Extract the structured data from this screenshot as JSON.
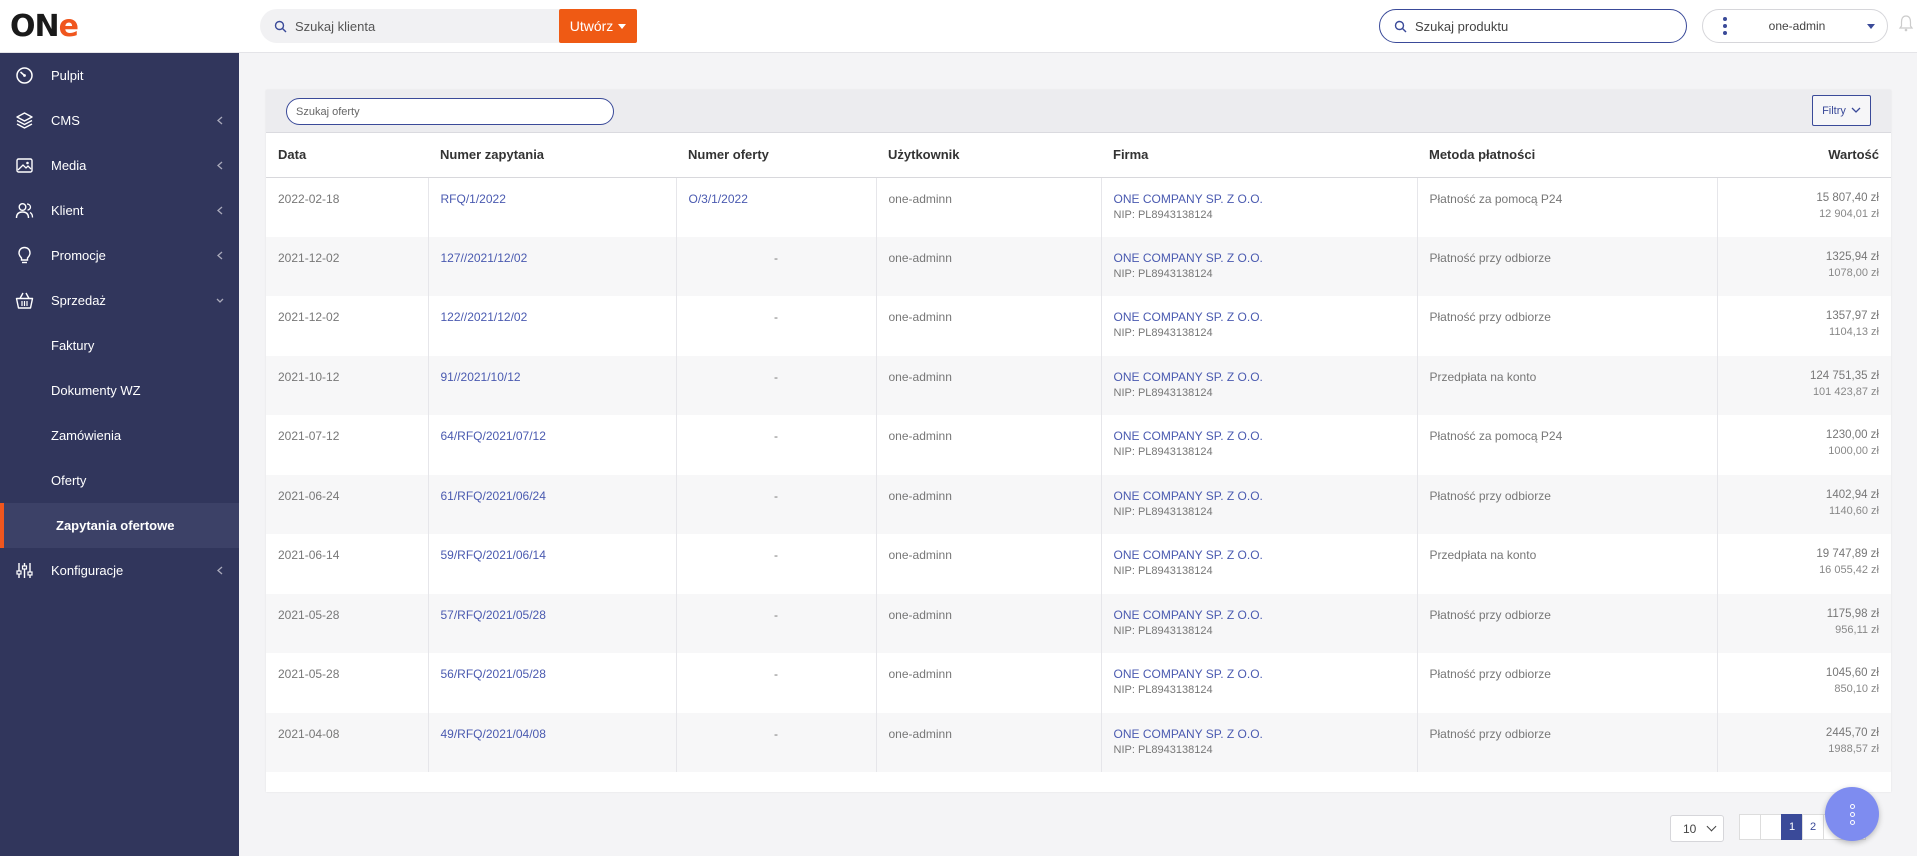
{
  "header": {
    "logo_text": "ON",
    "logo_accent": "e",
    "client_search_value": "Szukaj klienta",
    "create_label": "Utwórz",
    "product_search_value": "Szukaj produktu",
    "user_name": "one-admin",
    "accent_color": "#ef5a14",
    "brand_color": "#3a4a99"
  },
  "sidebar": {
    "items": [
      {
        "label": "Pulpit",
        "icon": "gauge-icon"
      },
      {
        "label": "CMS",
        "icon": "layers-icon"
      },
      {
        "label": "Media",
        "icon": "image-icon"
      },
      {
        "label": "Klient",
        "icon": "users-icon"
      },
      {
        "label": "Promocje",
        "icon": "lightbulb-icon"
      },
      {
        "label": "Sprzedaż",
        "icon": "basket-icon"
      },
      {
        "label": "Konfiguracje",
        "icon": "sliders-icon"
      }
    ],
    "sub_items": [
      "Faktury",
      "Dokumenty WZ",
      "Zamówienia",
      "Oferty",
      "Zapytania ofertowe"
    ]
  },
  "toolbar": {
    "offer_search_placeholder": "Szukaj oferty",
    "filter_label": "Filtry"
  },
  "table": {
    "columns": [
      "Data",
      "Numer zapytania",
      "Numer oferty",
      "Użytkownik",
      "Firma",
      "Metoda płatności",
      "Wartość"
    ],
    "rows": [
      {
        "date": "2022-02-18",
        "request": "RFQ/1/2022",
        "offer": "O/3/1/2022",
        "user": "one-adminn",
        "company": "ONE COMPANY SP. Z O.O.",
        "nip": "NIP: PL8943138124",
        "payment": "Płatność za pomocą P24",
        "gross": "15 807,40 zł",
        "net": "12 904,01 zł"
      },
      {
        "date": "2021-12-02",
        "request": "127//2021/12/02",
        "offer": "-",
        "user": "one-adminn",
        "company": "ONE COMPANY SP. Z O.O.",
        "nip": "NIP: PL8943138124",
        "payment": "Płatność przy odbiorze",
        "gross": "1325,94 zł",
        "net": "1078,00 zł"
      },
      {
        "date": "2021-12-02",
        "request": "122//2021/12/02",
        "offer": "-",
        "user": "one-adminn",
        "company": "ONE COMPANY SP. Z O.O.",
        "nip": "NIP: PL8943138124",
        "payment": "Płatność przy odbiorze",
        "gross": "1357,97 zł",
        "net": "1104,13 zł"
      },
      {
        "date": "2021-10-12",
        "request": "91//2021/10/12",
        "offer": "-",
        "user": "one-adminn",
        "company": "ONE COMPANY SP. Z O.O.",
        "nip": "NIP: PL8943138124",
        "payment": "Przedpłata na konto",
        "gross": "124 751,35 zł",
        "net": "101 423,87 zł"
      },
      {
        "date": "2021-07-12",
        "request": "64/RFQ/2021/07/12",
        "offer": "-",
        "user": "one-adminn",
        "company": "ONE COMPANY SP. Z O.O.",
        "nip": "NIP: PL8943138124",
        "payment": "Płatność za pomocą P24",
        "gross": "1230,00 zł",
        "net": "1000,00 zł"
      },
      {
        "date": "2021-06-24",
        "request": "61/RFQ/2021/06/24",
        "offer": "-",
        "user": "one-adminn",
        "company": "ONE COMPANY SP. Z O.O.",
        "nip": "NIP: PL8943138124",
        "payment": "Płatność przy odbiorze",
        "gross": "1402,94 zł",
        "net": "1140,60 zł"
      },
      {
        "date": "2021-06-14",
        "request": "59/RFQ/2021/06/14",
        "offer": "-",
        "user": "one-adminn",
        "company": "ONE COMPANY SP. Z O.O.",
        "nip": "NIP: PL8943138124",
        "payment": "Przedpłata na konto",
        "gross": "19 747,89 zł",
        "net": "16 055,42 zł"
      },
      {
        "date": "2021-05-28",
        "request": "57/RFQ/2021/05/28",
        "offer": "-",
        "user": "one-adminn",
        "company": "ONE COMPANY SP. Z O.O.",
        "nip": "NIP: PL8943138124",
        "payment": "Płatność przy odbiorze",
        "gross": "1175,98 zł",
        "net": "956,11 zł"
      },
      {
        "date": "2021-05-28",
        "request": "56/RFQ/2021/05/28",
        "offer": "-",
        "user": "one-adminn",
        "company": "ONE COMPANY SP. Z O.O.",
        "nip": "NIP: PL8943138124",
        "payment": "Płatność przy odbiorze",
        "gross": "1045,60 zł",
        "net": "850,10 zł"
      },
      {
        "date": "2021-04-08",
        "request": "49/RFQ/2021/04/08",
        "offer": "-",
        "user": "one-adminn",
        "company": "ONE COMPANY SP. Z O.O.",
        "nip": "NIP: PL8943138124",
        "payment": "Płatność przy odbiorze",
        "gross": "2445,70 zł",
        "net": "1988,57 zł"
      }
    ]
  },
  "pagination": {
    "page_size": "10",
    "pages": [
      "1",
      "2"
    ],
    "current_page": "1"
  }
}
